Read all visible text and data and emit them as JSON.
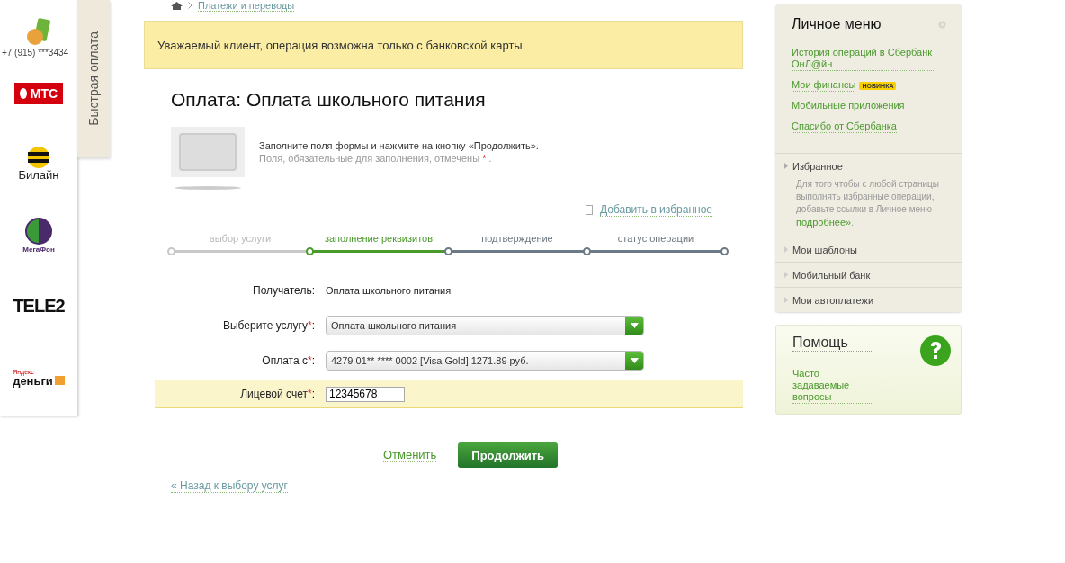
{
  "quick_pay": {
    "tab_label": "Быстрая оплата",
    "phone": "+7 (915) ***3434",
    "operators": [
      {
        "kind": "mts",
        "name": "МТС"
      },
      {
        "kind": "beeline",
        "name": "Билайн"
      },
      {
        "kind": "megafon",
        "name": "МегаФон"
      },
      {
        "kind": "tele2",
        "name": "TELE2"
      },
      {
        "kind": "yandex",
        "name": "деньги",
        "prefix": "Яндекс"
      }
    ]
  },
  "breadcrumb": "Платежи и переводы",
  "alert": "Уважаемый клиент, операция возможна только с банковской карты.",
  "title": "Оплата: Оплата школьного питания",
  "hint": {
    "line1": "Заполните поля формы и нажмите на кнопку «Продолжить».",
    "line2": "Поля, обязательные для заполнения, отмечены",
    "mark": "*",
    "end": "."
  },
  "favorite_link": "Добавить в избранное",
  "steps": [
    {
      "label": "выбор услуги",
      "kind": "past"
    },
    {
      "label": "заполнение реквизитов",
      "kind": "current"
    },
    {
      "label": "подтверждение",
      "kind": "future"
    },
    {
      "label": "статус операции",
      "kind": "future"
    }
  ],
  "form": [
    {
      "kind": "text",
      "label": "Получатель:",
      "highlighted": false,
      "value": "Оплата школьного питания"
    },
    {
      "kind": "select",
      "label": "Выберите услугу",
      "mark": "*",
      "suffix": ":",
      "required": true,
      "highlighted": false,
      "value": "Оплата школьного питания"
    },
    {
      "kind": "select",
      "label": "Оплата с",
      "mark": "*",
      "suffix": ":",
      "required": true,
      "highlighted": false,
      "value": "4279 01** **** 0002 [Visa Gold] 1271.89 руб."
    },
    {
      "kind": "input",
      "label": "Лицевой счет",
      "mark": "*",
      "suffix": ":",
      "required": true,
      "highlighted": true,
      "value": "12345678"
    }
  ],
  "cancel": "Отменить",
  "continue": "Продолжить",
  "back": "« Назад к выбору услуг",
  "menu": {
    "title": "Личное меню",
    "links": [
      {
        "label": "История операций в Сбербанк ОнЛ@йн"
      },
      {
        "label": "Мои финансы",
        "badge": "НОВИНКА"
      },
      {
        "label": "Мобильные приложения"
      },
      {
        "label": "Спасибо от Сбербанка"
      }
    ],
    "sections": [
      {
        "label": "Избранное",
        "expanded": true,
        "text": "Для того чтобы с любой страницы выполнять избранные операции, добавьте ссылки в Личное меню",
        "link": "подробнее»",
        "end": "."
      },
      {
        "label": "Мои шаблоны",
        "expanded": false
      },
      {
        "label": "Мобильный банк",
        "expanded": false
      },
      {
        "label": "Мои автоплатежи",
        "expanded": false
      }
    ]
  },
  "help": {
    "title": "Помощь",
    "link": "Часто задаваемые вопросы"
  }
}
